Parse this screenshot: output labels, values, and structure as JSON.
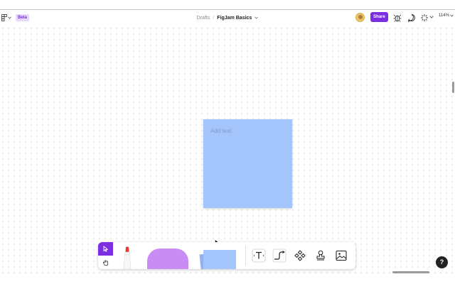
{
  "header": {
    "beta_badge": "Beta",
    "breadcrumb_parent": "Drafts",
    "breadcrumb_sep": "/",
    "file_name": "FigJam Basics",
    "share_label": "Share",
    "zoom_level": "114%"
  },
  "canvas": {
    "sticky_placeholder": "Add text",
    "sticky_color": "#a4c5fb"
  },
  "toolbar": {
    "accent": "#7b2fe0",
    "tools": [
      "select-tool",
      "hand-tool",
      "marker-tool",
      "shape-tool",
      "sticky-note-tool",
      "text-tool",
      "connector-tool",
      "component-tool",
      "stamp-tool",
      "image-tool"
    ]
  },
  "help": {
    "label": "?"
  },
  "icons": {
    "menu": "figma-menu-icon",
    "multiplayer": "bug-icon",
    "comment": "comment-icon",
    "spotlight": "sparkle-icon"
  }
}
